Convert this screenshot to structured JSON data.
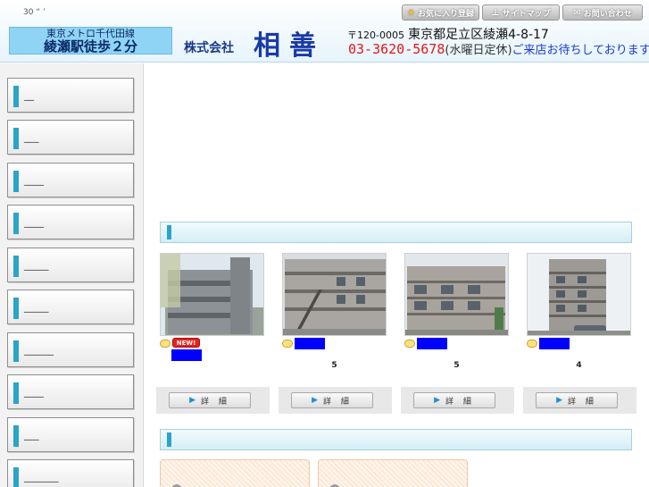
{
  "header": {
    "tiny_text": "30 “  ’",
    "station_line": "東京メトロ千代田線",
    "station_walk": "綾瀬駅徒歩２分",
    "company_prefix": "株式会社",
    "company_name": "相善",
    "zip": "〒120-0005",
    "address": "東京都足立区綾瀬4-8-17",
    "phone": "03-3620-5678",
    "holiday": "(水曜日定休)",
    "welcome": "ご来店お待ちしております",
    "buttons": {
      "favorite": "お気に入り登録",
      "sitemap": "サイトマップ",
      "contact": "お問い合わせ"
    },
    "icons": {
      "favorite": "star-icon",
      "sitemap": "sitemap-icon",
      "contact": "envelope-icon"
    }
  },
  "sidebar": {
    "items": [
      {
        "label": "__"
      },
      {
        "label": "___"
      },
      {
        "label": "____"
      },
      {
        "label": "____"
      },
      {
        "label": "_____"
      },
      {
        "label": "_____"
      },
      {
        "label": "______"
      },
      {
        "label": "____"
      },
      {
        "label": "___"
      },
      {
        "label": "_______"
      }
    ]
  },
  "listings": [
    {
      "badge": "NEW!",
      "count": "",
      "detail": "詳 細",
      "image": "building-photo"
    },
    {
      "badge": "",
      "count": "5",
      "detail": "詳 細",
      "image": "building-photo"
    },
    {
      "badge": "",
      "count": "5",
      "detail": "詳 細",
      "image": "building-photo"
    },
    {
      "badge": "",
      "count": "4",
      "detail": "詳 細",
      "image": "building-photo"
    }
  ],
  "colors": {
    "accent": "#2aa4c8",
    "phone": "#e01818",
    "company": "#1a3aa8",
    "placeholder_block": "#0000ff"
  }
}
